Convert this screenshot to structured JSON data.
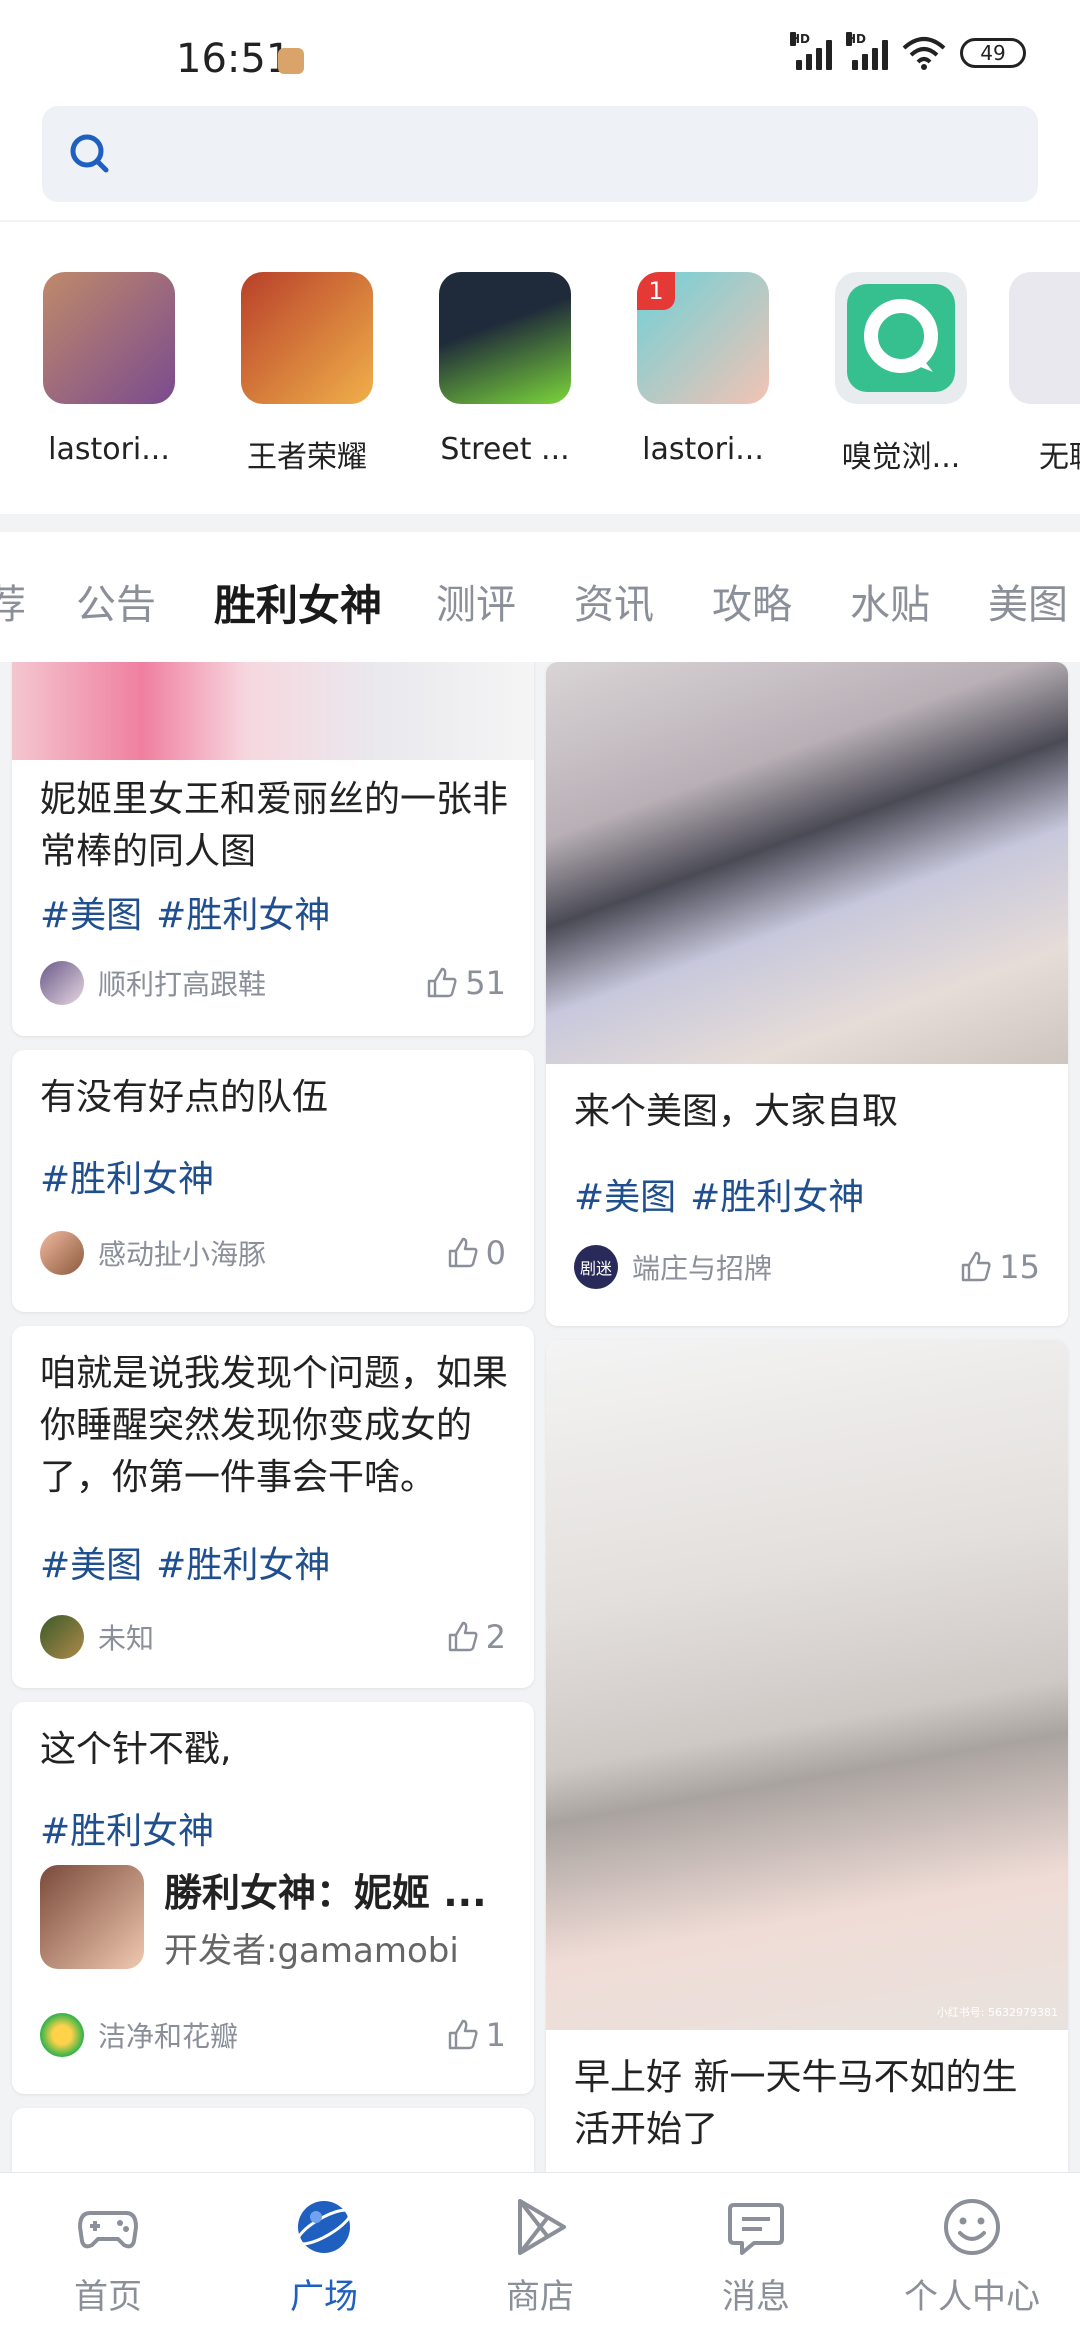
{
  "status": {
    "time": "16:51",
    "battery": "49",
    "hd": "HD"
  },
  "search": {
    "placeholder": ""
  },
  "apps": [
    {
      "name": "lastori...",
      "colors": [
        "#c08a6a",
        "#7a4b8f"
      ]
    },
    {
      "name": "王者荣耀",
      "colors": [
        "#b8402a",
        "#f0b04a"
      ]
    },
    {
      "name": "Street ...",
      "colors": [
        "#1f2a3a",
        "#7bd63a"
      ]
    },
    {
      "name": "lastori...",
      "colors": [
        "#6fd0d8",
        "#f3c3b3"
      ],
      "badge": "1"
    },
    {
      "name": "嗅觉浏...",
      "colors": [
        "#36c08f",
        "#36c08f"
      ]
    },
    {
      "name": "无聊",
      "colors": [
        "#e8e8ee",
        "#1d2440"
      ]
    }
  ],
  "tabs": [
    "荐",
    "公告",
    "胜利女神",
    "测评",
    "资讯",
    "攻略",
    "水贴",
    "美图"
  ],
  "active_tab": "胜利女神",
  "left_cards": [
    {
      "title": "妮姬里女王和爱丽丝的一张非常棒的同人图",
      "tags": [
        "#美图",
        "#胜利女神"
      ],
      "author": "顺利打高跟鞋",
      "likes": "51"
    },
    {
      "title": "有没有好点的队伍",
      "tags": [
        "#胜利女神"
      ],
      "author": "感动扯小海豚",
      "likes": "0"
    },
    {
      "title": "咱就是说我发现个问题，如果你睡醒突然发现你变成女的了，你第一件事会干啥。",
      "tags": [
        "#美图",
        "#胜利女神"
      ],
      "author": "未知",
      "likes": "2"
    },
    {
      "title": "这个针不戳,",
      "tags": [
        "#胜利女神"
      ],
      "game_name": "勝利女神：妮姬 ...",
      "game_dev": "开发者:gamamobi",
      "author": "洁净和花瓣",
      "likes": "1"
    }
  ],
  "right_cards": [
    {
      "title": "来个美图，大家自取",
      "tags": [
        "#美图",
        "#胜利女神"
      ],
      "author": "端庄与招牌",
      "avatar_text": "剧迷",
      "likes": "15"
    },
    {
      "title": "早上好 新一天牛马不如的生活开始了",
      "watermark": "小红书号: 5632979381"
    }
  ],
  "nav": [
    "首页",
    "广场",
    "商店",
    "消息",
    "个人中心"
  ],
  "accent": "#1f5fbf",
  "tag_color": "#1f4f8f"
}
